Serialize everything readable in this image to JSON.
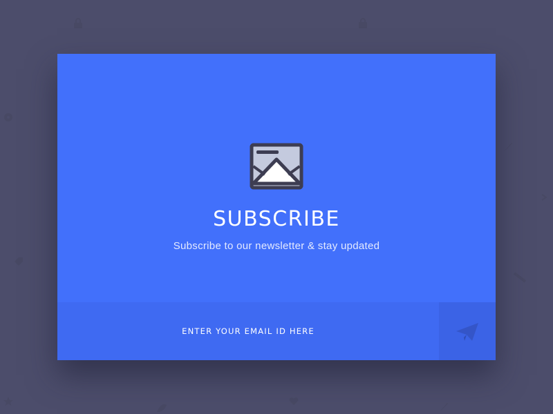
{
  "subscribe_card": {
    "title": "SUBSCRIBE",
    "subtitle": "Subscribe to our newsletter & stay updated",
    "email_placeholder": "ENTER YOUR EMAIL ID HERE",
    "send_icon": "paper-plane-icon",
    "envelope_icon": "envelope-icon"
  },
  "colors": {
    "page_background": "#4c4d6b",
    "card_background": "#4270fb",
    "input_bar": "#3f6af2",
    "send_button": "#3b63e6",
    "icon_outline": "#3d3d52",
    "icon_paper": "#c4cade"
  }
}
